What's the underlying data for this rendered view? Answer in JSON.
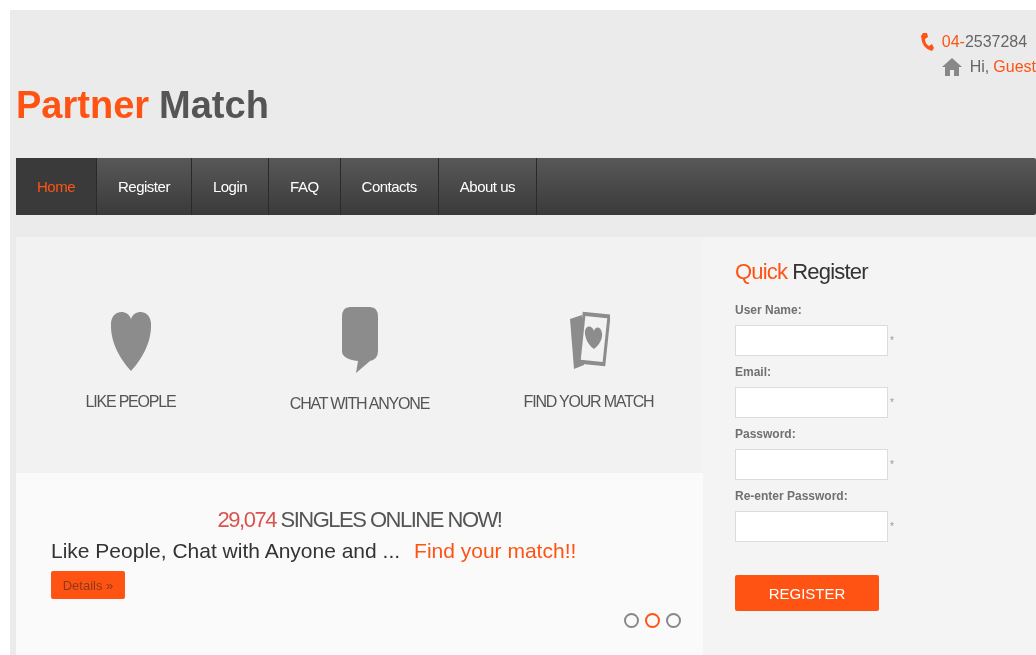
{
  "header": {
    "phone": {
      "area": "04-",
      "number": "2537284"
    },
    "greeting": {
      "hi": "Hi,",
      "name": "Guest"
    },
    "logo": {
      "first": "Partner",
      "second": "Match"
    }
  },
  "nav": [
    {
      "label": "Home",
      "selected": true
    },
    {
      "label": "Register",
      "selected": false
    },
    {
      "label": "Login",
      "selected": false
    },
    {
      "label": "FAQ",
      "selected": false
    },
    {
      "label": "Contacts",
      "selected": false
    },
    {
      "label": "About us",
      "selected": false
    }
  ],
  "features": [
    {
      "kind": "heart",
      "label": "LIKE PEOPLE"
    },
    {
      "kind": "bubble",
      "label": "CHAT WITH ANYONE"
    },
    {
      "kind": "cards",
      "label": "FIND YOUR MATCH"
    }
  ],
  "banner": {
    "count": "29,074",
    "text": "SINGLES ONLINE NOW!"
  },
  "slide": {
    "lead": "Like People, Chat with Anyone and ...",
    "highlight": "Find your match!!",
    "button": "Details »"
  },
  "slider_dots": [
    {
      "selected": false
    },
    {
      "selected": true
    },
    {
      "selected": false
    }
  ],
  "register": {
    "title_first": "Quick",
    "title_second": "Register",
    "fields": [
      {
        "label": "User Name:",
        "required": "*"
      },
      {
        "label": "Email:",
        "required": "*"
      },
      {
        "label": "Password:",
        "required": "*"
      },
      {
        "label": "Re-enter Password:",
        "required": "*"
      }
    ],
    "button": "REGISTER"
  }
}
